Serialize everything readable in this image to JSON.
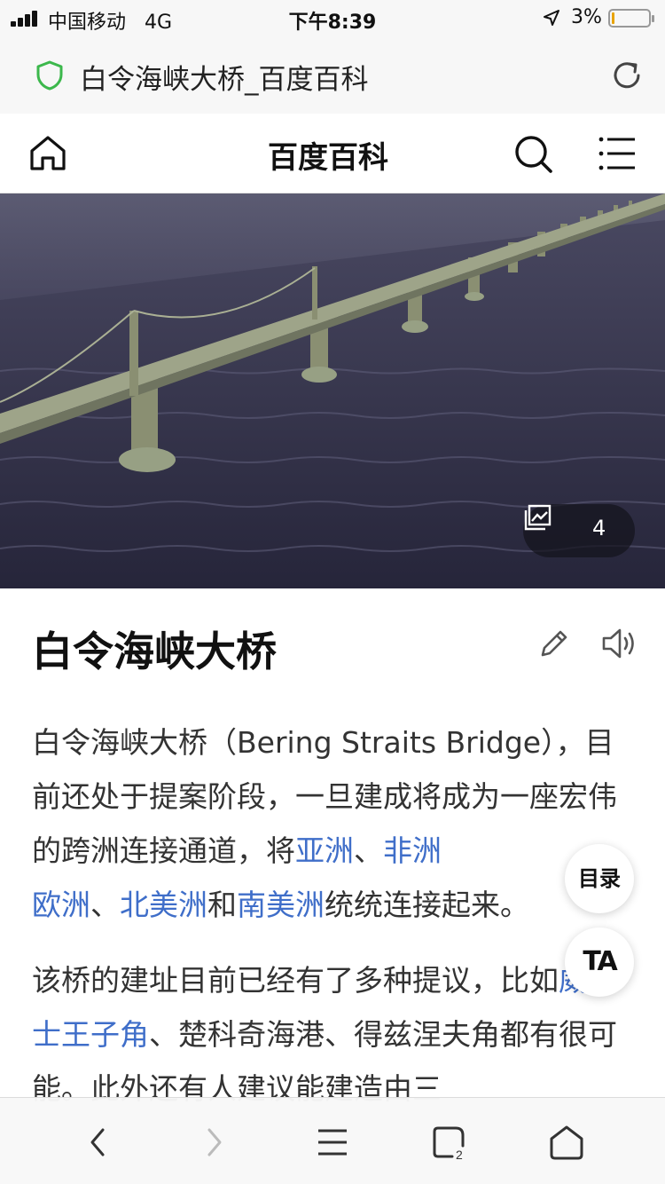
{
  "status_bar": {
    "carrier": "中国移动",
    "network": "4G",
    "time": "下午8:39",
    "battery_percent_label": "3%",
    "battery_level": 0.03,
    "battery_color": "#e8a300"
  },
  "address_bar": {
    "page_title": "白令海峡大桥_百度百科",
    "security_icon": "green-shield-icon",
    "security_color": "#3cb84c",
    "reload_icon": "reload-icon"
  },
  "nav": {
    "title": "百度百科",
    "home_icon": "home-icon",
    "search_icon": "search-icon",
    "menu_icon": "hamburger-menu-icon"
  },
  "hero": {
    "image_description_icon": "bridge-photo",
    "gallery_icon": "image-gallery-icon",
    "gallery_count": "4"
  },
  "article": {
    "title": "白令海峡大桥",
    "edit_icon": "pencil-icon",
    "audio_icon": "speaker-icon",
    "p1": {
      "intro": "白令海峡大桥（Bering Straits Bridge），目前还处于提案阶段，一旦建成将成为一座宏伟的跨洲连接通道，将",
      "link_asia": "亚洲",
      "sep1": "、",
      "link_africa": "非洲",
      "sep2": "",
      "link_europe": "欧洲",
      "sep3": "、",
      "link_north_america": "北美洲",
      "and": "和",
      "link_south_america": "南美洲",
      "outro": "统统连接起来。"
    },
    "p2": {
      "intro": "该桥的建址目前已经有了多种提议，比如",
      "link_wales": "威尔士王子角",
      "rest": "、楚科奇海港、得兹涅夫角都有很可能。此外还有人建议能建造由三"
    },
    "link_color": "#3f6ec9"
  },
  "floating": {
    "toc_label": "目录",
    "text_size_label": "TA"
  },
  "bottom_toolbar": {
    "icons": [
      "back-icon",
      "forward-icon",
      "menu-icon",
      "tabs-icon",
      "home-icon"
    ],
    "tabs_count": "2"
  }
}
